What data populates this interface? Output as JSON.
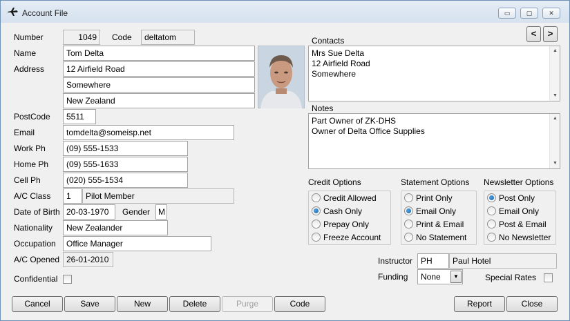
{
  "window": {
    "title": "Account File",
    "icon": "plane-icon"
  },
  "window_controls": {
    "minimize": "▭",
    "restore": "▢",
    "close": "✕"
  },
  "form": {
    "number_label": "Number",
    "number": "1049",
    "code_label": "Code",
    "code": "deltatom",
    "name_label": "Name",
    "name": "Tom Delta",
    "address_label": "Address",
    "address1": "12 Airfield Road",
    "address2": "Somewhere",
    "address3": "New Zealand",
    "postcode_label": "PostCode",
    "postcode": "5511",
    "email_label": "Email",
    "email": "tomdelta@someisp.net",
    "workph_label": "Work Ph",
    "workph": "(09) 555-1533",
    "homeph_label": "Home Ph",
    "homeph": "(09) 555-1633",
    "cellph_label": "Cell Ph",
    "cellph": "(020) 555-1534",
    "acclass_label": "A/C Class",
    "acclass_code": "1",
    "acclass_name": "Pilot Member",
    "dob_label": "Date of Birth",
    "dob": "20-03-1970",
    "gender_label": "Gender",
    "gender": "M",
    "nationality_label": "Nationality",
    "nationality": "New Zealander",
    "occupation_label": "Occupation",
    "occupation": "Office Manager",
    "acopened_label": "A/C Opened",
    "acopened": "26-01-2010",
    "confidential_label": "Confidential",
    "confidential": false
  },
  "nav": {
    "prev": "<",
    "next": ">"
  },
  "contacts": {
    "label": "Contacts",
    "lines": [
      "Mrs Sue Delta",
      "12 Airfield Road",
      "Somewhere"
    ]
  },
  "notes": {
    "label": "Notes",
    "lines": [
      "Part Owner of ZK-DHS",
      "Owner of Delta Office Supplies"
    ]
  },
  "credit_options": {
    "label": "Credit Options",
    "options": [
      {
        "label": "Credit Allowed",
        "selected": false
      },
      {
        "label": "Cash Only",
        "selected": true
      },
      {
        "label": "Prepay Only",
        "selected": false
      },
      {
        "label": "Freeze Account",
        "selected": false
      }
    ]
  },
  "statement_options": {
    "label": "Statement Options",
    "options": [
      {
        "label": "Print Only",
        "selected": false
      },
      {
        "label": "Email Only",
        "selected": true
      },
      {
        "label": "Print & Email",
        "selected": false
      },
      {
        "label": "No Statement",
        "selected": false
      }
    ]
  },
  "newsletter_options": {
    "label": "Newsletter Options",
    "options": [
      {
        "label": "Post Only",
        "selected": true
      },
      {
        "label": "Email Only",
        "selected": false
      },
      {
        "label": "Post & Email",
        "selected": false
      },
      {
        "label": "No Newsletter",
        "selected": false
      }
    ]
  },
  "instructor": {
    "label": "Instructor",
    "code": "PH",
    "name": "Paul Hotel"
  },
  "funding": {
    "label": "Funding",
    "value": "None"
  },
  "special_rates": {
    "label": "Special Rates",
    "checked": false
  },
  "buttons": {
    "cancel": "Cancel",
    "save": "Save",
    "new": "New",
    "delete": "Delete",
    "purge": "Purge",
    "code": "Code",
    "report": "Report",
    "close": "Close"
  },
  "colors": {
    "window_bg": "#f0f0f0",
    "radio_selected": "#1a5fa3",
    "disabled_text": "#a0a0a0"
  }
}
